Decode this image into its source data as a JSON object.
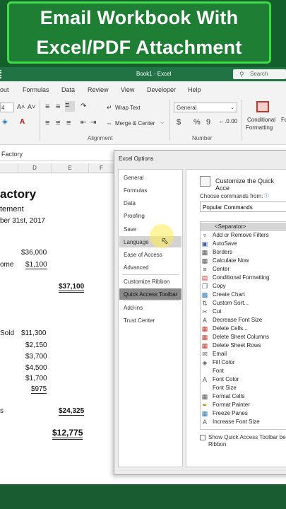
{
  "banner": {
    "line1": "Email Workbook With",
    "line2": "Excel/PDF Attachment"
  },
  "titlebar": {
    "title": "Book1 - Excel",
    "search_placeholder": "Search"
  },
  "menu": {
    "items": [
      "out",
      "Formulas",
      "Data",
      "Review",
      "View",
      "Developer",
      "Help"
    ]
  },
  "ribbon": {
    "font_size": "4",
    "grow_font": "A˄",
    "shrink_font": "A˅",
    "wrap_text": "Wrap Text",
    "merge_center": "Merge & Center",
    "alignment_label": "Alignment",
    "number_format": "General",
    "currency": "$",
    "percent": "%",
    "comma": "9",
    "number_label": "Number",
    "conditional_formatting_line1": "Conditional",
    "conditional_formatting_line2": "Formatting",
    "format_as_table_partial": "Fo"
  },
  "formula_bar": {
    "name_box": "Factory"
  },
  "sheet": {
    "columns": [
      "D",
      "E",
      "F"
    ],
    "title": "actory",
    "subtitle": "tement",
    "date": "ber 31st, 2017",
    "rows": [
      {
        "label": "",
        "d": "$36,000",
        "e": ""
      },
      {
        "label": "ome",
        "d": "$1,100",
        "e": ""
      },
      {
        "label": "",
        "d": "",
        "e": "$37,100"
      },
      {
        "label": "Sold",
        "d": "$11,300",
        "e": ""
      },
      {
        "label": "",
        "d": "$2,150",
        "e": ""
      },
      {
        "label": "",
        "d": "$3,700",
        "e": ""
      },
      {
        "label": "",
        "d": "$4,500",
        "e": ""
      },
      {
        "label": "",
        "d": "$1,700",
        "e": ""
      },
      {
        "label": "",
        "d": "$975",
        "e": ""
      },
      {
        "label": "s",
        "d": "",
        "e": "$24,325"
      },
      {
        "label": "",
        "d": "",
        "e": "$12,775"
      }
    ]
  },
  "dialog": {
    "title": "Excel Options",
    "nav": [
      "General",
      "Formulas",
      "Data",
      "Proofing",
      "Save",
      "Language",
      "Ease of Access",
      "Advanced",
      "Customize Ribbon",
      "Quick Access Toolbar",
      "Add-ins",
      "Trust Center"
    ],
    "selected": "Quick Access Toolbar",
    "hovered": "Language",
    "heading": "Customize the Quick Acce",
    "choose_label": "Choose commands from:",
    "choose_value": "Popular Commands",
    "commands": [
      "<Separator>",
      "Add or Remove Filters",
      "AutoSave",
      "Borders",
      "Calculate Now",
      "Center",
      "Conditional Formatting",
      "Copy",
      "Create Chart",
      "Custom Sort...",
      "Cut",
      "Decrease Font Size",
      "Delete Cells...",
      "Delete Sheet Columns",
      "Delete Sheet Rows",
      "Email",
      "Fill Color",
      "Font",
      "Font Color",
      "Font Size",
      "Format Cells",
      "Format Painter",
      "Freeze Panes",
      "Increase Font Size"
    ],
    "show_below_line1": "Show Quick Access Toolbar bel",
    "show_below_line2": "Ribbon"
  }
}
